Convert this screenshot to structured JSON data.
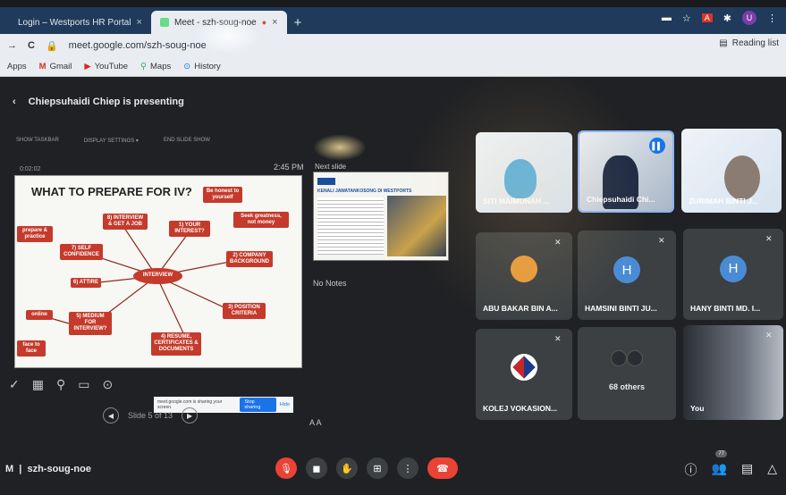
{
  "browser": {
    "tabs": [
      {
        "label": "Login – Westports HR Portal",
        "close": "×"
      },
      {
        "label": "Meet - szh-soug-noe",
        "close": "×"
      }
    ],
    "new_tab": "+",
    "url": "meet.google.com/szh-soug-noe",
    "reading_list": "Reading list",
    "bookmarks": [
      "Apps",
      "Gmail",
      "YouTube",
      "Maps",
      "History"
    ]
  },
  "meet": {
    "presenting_text": "Chiepsuhaidi Chiep is presenting",
    "meeting_code": "szh-soug-noe",
    "participants_count": "77",
    "others_label": "68 others",
    "participants": [
      {
        "name": "SITI MAIMUNAH ..."
      },
      {
        "name": "Chiepsuhaidi Chi..."
      },
      {
        "name": "ZURIMAH BINTI J..."
      },
      {
        "name": "ABU BAKAR BIN A..."
      },
      {
        "name": "HAMSINI BINTI JU...",
        "initial": "H"
      },
      {
        "name": "HANY BINTI MD. I...",
        "initial": "H"
      },
      {
        "name": "KOLEJ VOKASION..."
      },
      {
        "name": "You"
      }
    ]
  },
  "presenter": {
    "toolbar": [
      "SHOW TASKBAR",
      "DISPLAY SETTINGS ▾",
      "END SLIDE SHOW"
    ],
    "timer": "0:02:02",
    "clock": "2:45 PM",
    "next_slide_label": "Next slide",
    "notes": "No Notes",
    "slide_counter": "Slide 5 of 13",
    "font_controls": "A  A",
    "share_text": "meet.google.com is sharing your screen.",
    "stop_sharing": "Stop sharing",
    "hide": "Hide",
    "next_slide_title": "KENALI JAWATANKOSONG DI WESTPORTS"
  },
  "slide": {
    "title": "WHAT TO PREPARE FOR IV?",
    "center": "INTERVIEW",
    "nodes": [
      "8) INTERVIEW & GET A JOB",
      "1) YOUR INTEREST?",
      "2) COMPANY BACKGROUND",
      "3) POSITION CRITERIA",
      "4) RESUME, CERTIFICATES & DOCUMENTS",
      "5) MEDIUM FOR INTERVIEW?",
      "6) ATTIRE",
      "7) SELF CONFIDENCE"
    ],
    "side_notes": [
      "Be honest to yourself",
      "Seek greatness, not money",
      "prepare & practice",
      "online",
      "face to face"
    ]
  },
  "colors": {
    "accent": "#1a73e8",
    "danger": "#ea4335",
    "node": "#c53a2b"
  }
}
